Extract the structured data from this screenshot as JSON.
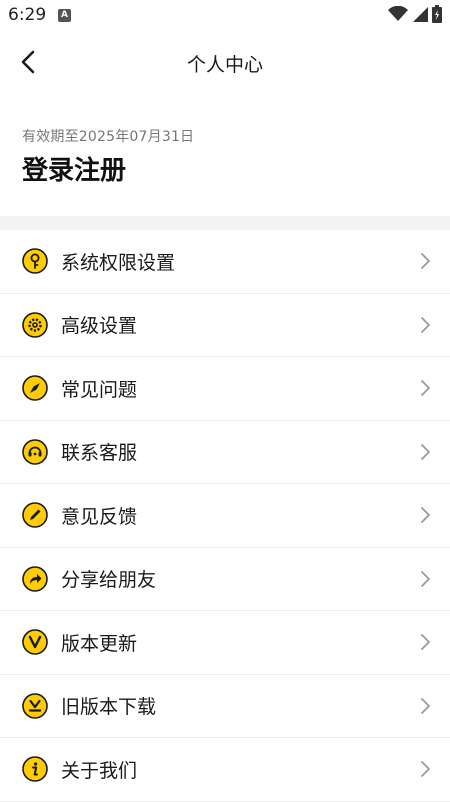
{
  "status_bar": {
    "time": "6:29",
    "notification_badge": "A"
  },
  "header": {
    "title": "个人中心"
  },
  "profile": {
    "expiry": "有效期至2025年07月31日",
    "login_label": "登录注册"
  },
  "colors": {
    "accent": "#FFCC00",
    "icon_stroke": "#1a1a1a",
    "divider": "#ececec"
  },
  "menu": {
    "items": [
      {
        "label": "系统权限设置",
        "icon": "key-icon"
      },
      {
        "label": "高级设置",
        "icon": "gear-icon"
      },
      {
        "label": "常见问题",
        "icon": "compass-icon"
      },
      {
        "label": "联系客服",
        "icon": "headset-icon"
      },
      {
        "label": "意见反馈",
        "icon": "pencil-icon"
      },
      {
        "label": "分享给朋友",
        "icon": "share-icon"
      },
      {
        "label": "版本更新",
        "icon": "version-icon"
      },
      {
        "label": "旧版本下载",
        "icon": "download-icon"
      },
      {
        "label": "关于我们",
        "icon": "info-icon"
      }
    ]
  }
}
